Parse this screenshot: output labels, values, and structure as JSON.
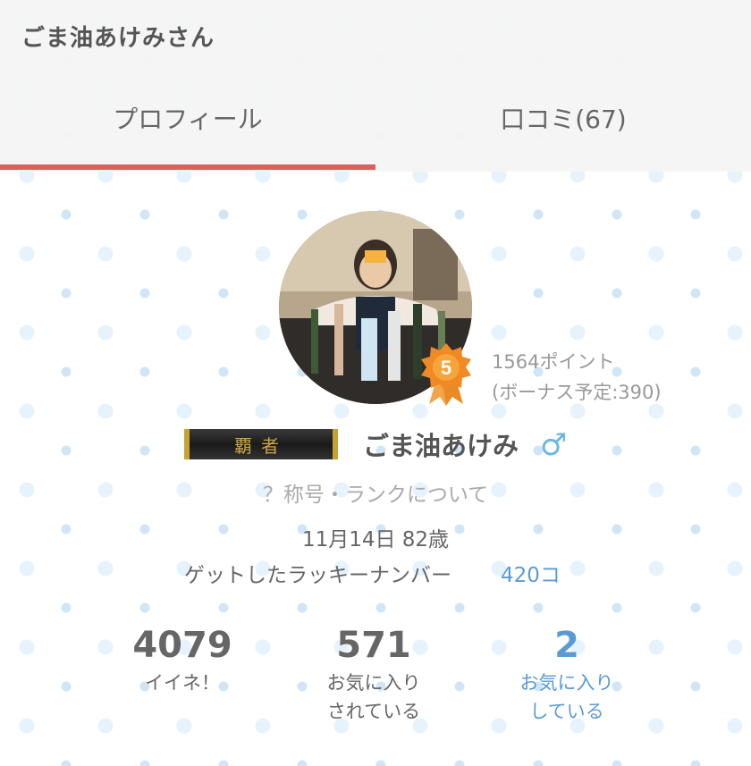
{
  "header": {
    "title": "ごま油あけみさん",
    "tabs": [
      {
        "label": "プロフィール",
        "active": true
      },
      {
        "label": "口コミ(67)",
        "active": false
      }
    ]
  },
  "profile": {
    "avatar_icon": "user-photo",
    "rank_number": "5",
    "points": "1564ポイント",
    "bonus": "(ボーナス予定:390)",
    "rank_title": "覇者",
    "username": "ごま油あけみ",
    "gender_symbol": "♂",
    "rank_help": "？称号・ランクについて",
    "birthday": "11月14日 82歳",
    "lucky_label": "ゲットしたラッキーナンバー",
    "lucky_count": "420コ"
  },
  "stats": [
    {
      "value": "4079",
      "label_line1": "イイネ！",
      "label_line2": ""
    },
    {
      "value": "571",
      "label_line1": "お気に入り",
      "label_line2": "されている"
    },
    {
      "value": "2",
      "label_line1": "お気に入り",
      "label_line2": "している"
    }
  ],
  "colors": {
    "accent": "#d9625b",
    "link": "#5b9bd5",
    "gender": "#6bb8e4",
    "badge": "#f08a24"
  }
}
